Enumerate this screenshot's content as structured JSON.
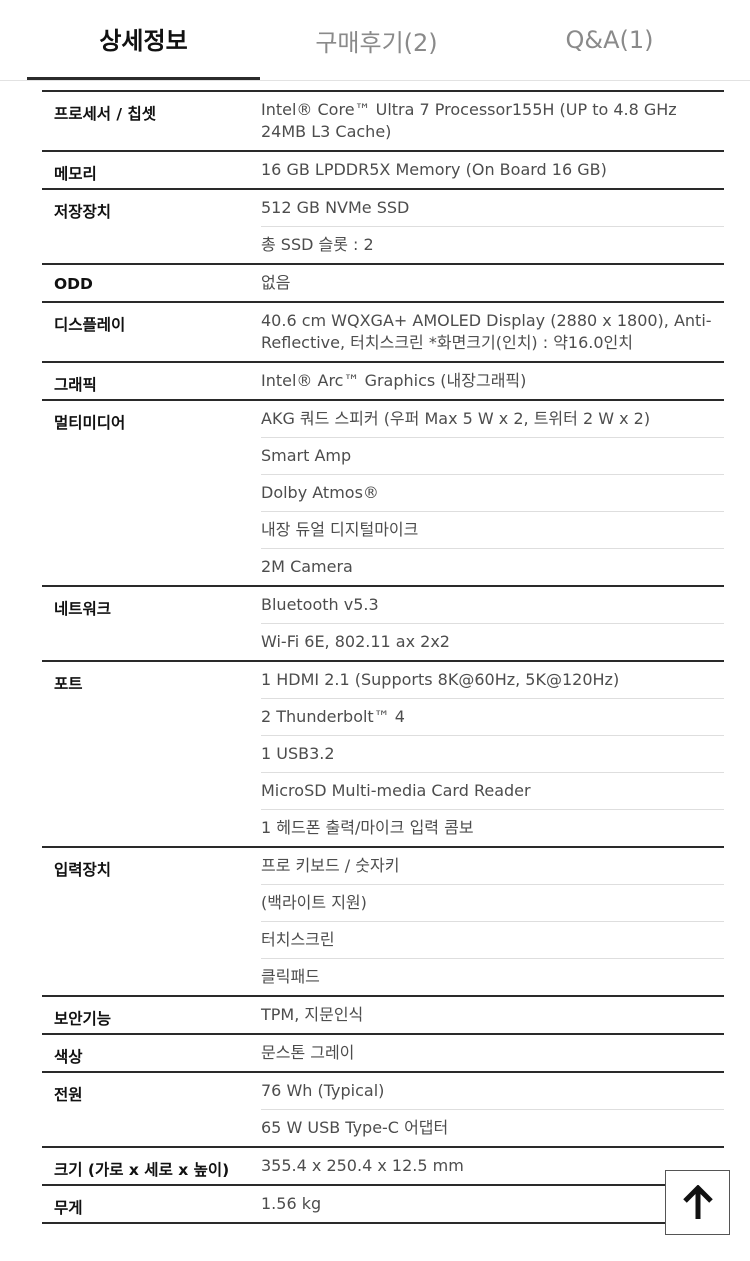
{
  "tabs": [
    {
      "label": "상세정보"
    },
    {
      "label": "구매후기(2)"
    },
    {
      "label": "Q&A(1)"
    }
  ],
  "specs": [
    {
      "label": "프로세서 / 칩셋",
      "values": [
        "Intel® Core™ Ultra 7 Processor155H (UP to 4.8 GHz 24MB L3 Cache)"
      ]
    },
    {
      "label": "메모리",
      "values": [
        "16 GB LPDDR5X Memory (On Board 16 GB)"
      ]
    },
    {
      "label": "저장장치",
      "values": [
        "512 GB NVMe SSD",
        "총 SSD 슬롯 : 2"
      ]
    },
    {
      "label": "ODD",
      "values": [
        "없음"
      ]
    },
    {
      "label": "디스플레이",
      "values": [
        "40.6 cm WQXGA+ AMOLED Display (2880 x 1800), Anti-Reflective, 터치스크린 *화면크기(인치) : 약16.0인치"
      ]
    },
    {
      "label": "그래픽",
      "values": [
        "Intel® Arc™ Graphics (내장그래픽)"
      ]
    },
    {
      "label": "멀티미디어",
      "values": [
        "AKG 쿼드 스피커 (우퍼 Max 5 W x 2, 트위터 2 W x 2)",
        "Smart Amp",
        "Dolby Atmos®",
        "내장 듀얼 디지털마이크",
        "2M Camera"
      ]
    },
    {
      "label": "네트워크",
      "values": [
        "Bluetooth v5.3",
        "Wi-Fi 6E, 802.11 ax 2x2"
      ]
    },
    {
      "label": "포트",
      "values": [
        "1 HDMI 2.1 (Supports 8K@60Hz, 5K@120Hz)",
        "2 Thunderbolt™ 4",
        "1 USB3.2",
        "MicroSD Multi-media Card Reader",
        "1 헤드폰 출력/마이크 입력 콤보"
      ]
    },
    {
      "label": "입력장치",
      "values": [
        "프로 키보드 / 숫자키",
        "(백라이트 지원)",
        "터치스크린",
        "클릭패드"
      ]
    },
    {
      "label": "보안기능",
      "values": [
        "TPM, 지문인식"
      ]
    },
    {
      "label": "색상",
      "values": [
        "문스톤 그레이"
      ]
    },
    {
      "label": "전원",
      "values": [
        "76 Wh (Typical)",
        "65 W USB Type-C 어댑터"
      ]
    },
    {
      "label": "크기 (가로 x 세로 x 높이)",
      "values": [
        "355.4 x 250.4 x 12.5 mm"
      ]
    },
    {
      "label": "무게",
      "values": [
        "1.56 kg"
      ]
    }
  ],
  "icons": {
    "scroll_top": "arrow-up-icon"
  }
}
